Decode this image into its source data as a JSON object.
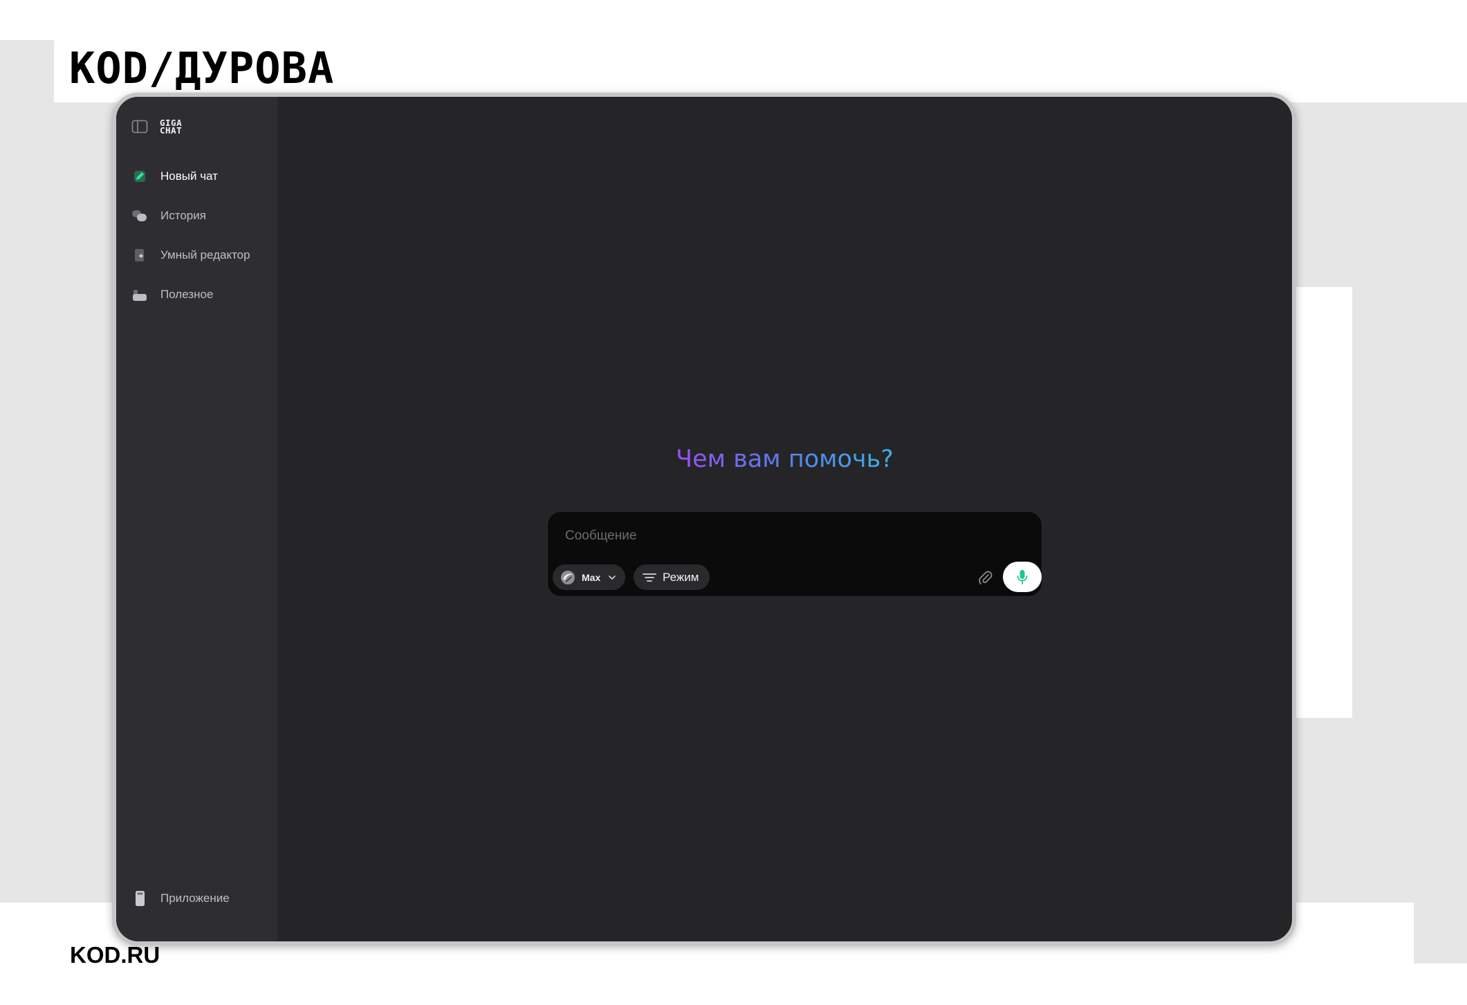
{
  "page": {
    "brand_logo": "KOD/ДУРОВА",
    "footer_link": "KOD.RU"
  },
  "app": {
    "logo_text_top": "GIGA",
    "logo_text_bottom": "CHAT",
    "accent_color": "#21c789",
    "sidebar": {
      "toggle_icon": "sidebar-panel-icon",
      "items": [
        {
          "label": "Новый чат",
          "icon": "pencil-icon",
          "active": true
        },
        {
          "label": "История",
          "icon": "chat-bubbles-icon",
          "active": false
        },
        {
          "label": "Умный редактор",
          "icon": "smart-document-icon",
          "active": false
        },
        {
          "label": "Полезное",
          "icon": "useful-folder-icon",
          "active": false
        }
      ],
      "bottom_item": {
        "label": "Приложение",
        "icon": "phone-icon"
      }
    },
    "main": {
      "greeting": "Чем вам помочь?",
      "composer": {
        "placeholder": "Сообщение",
        "model_label": "Max",
        "mode_label": "Режим",
        "attach_icon": "paperclip-icon",
        "mic_icon": "microphone-icon"
      }
    }
  }
}
